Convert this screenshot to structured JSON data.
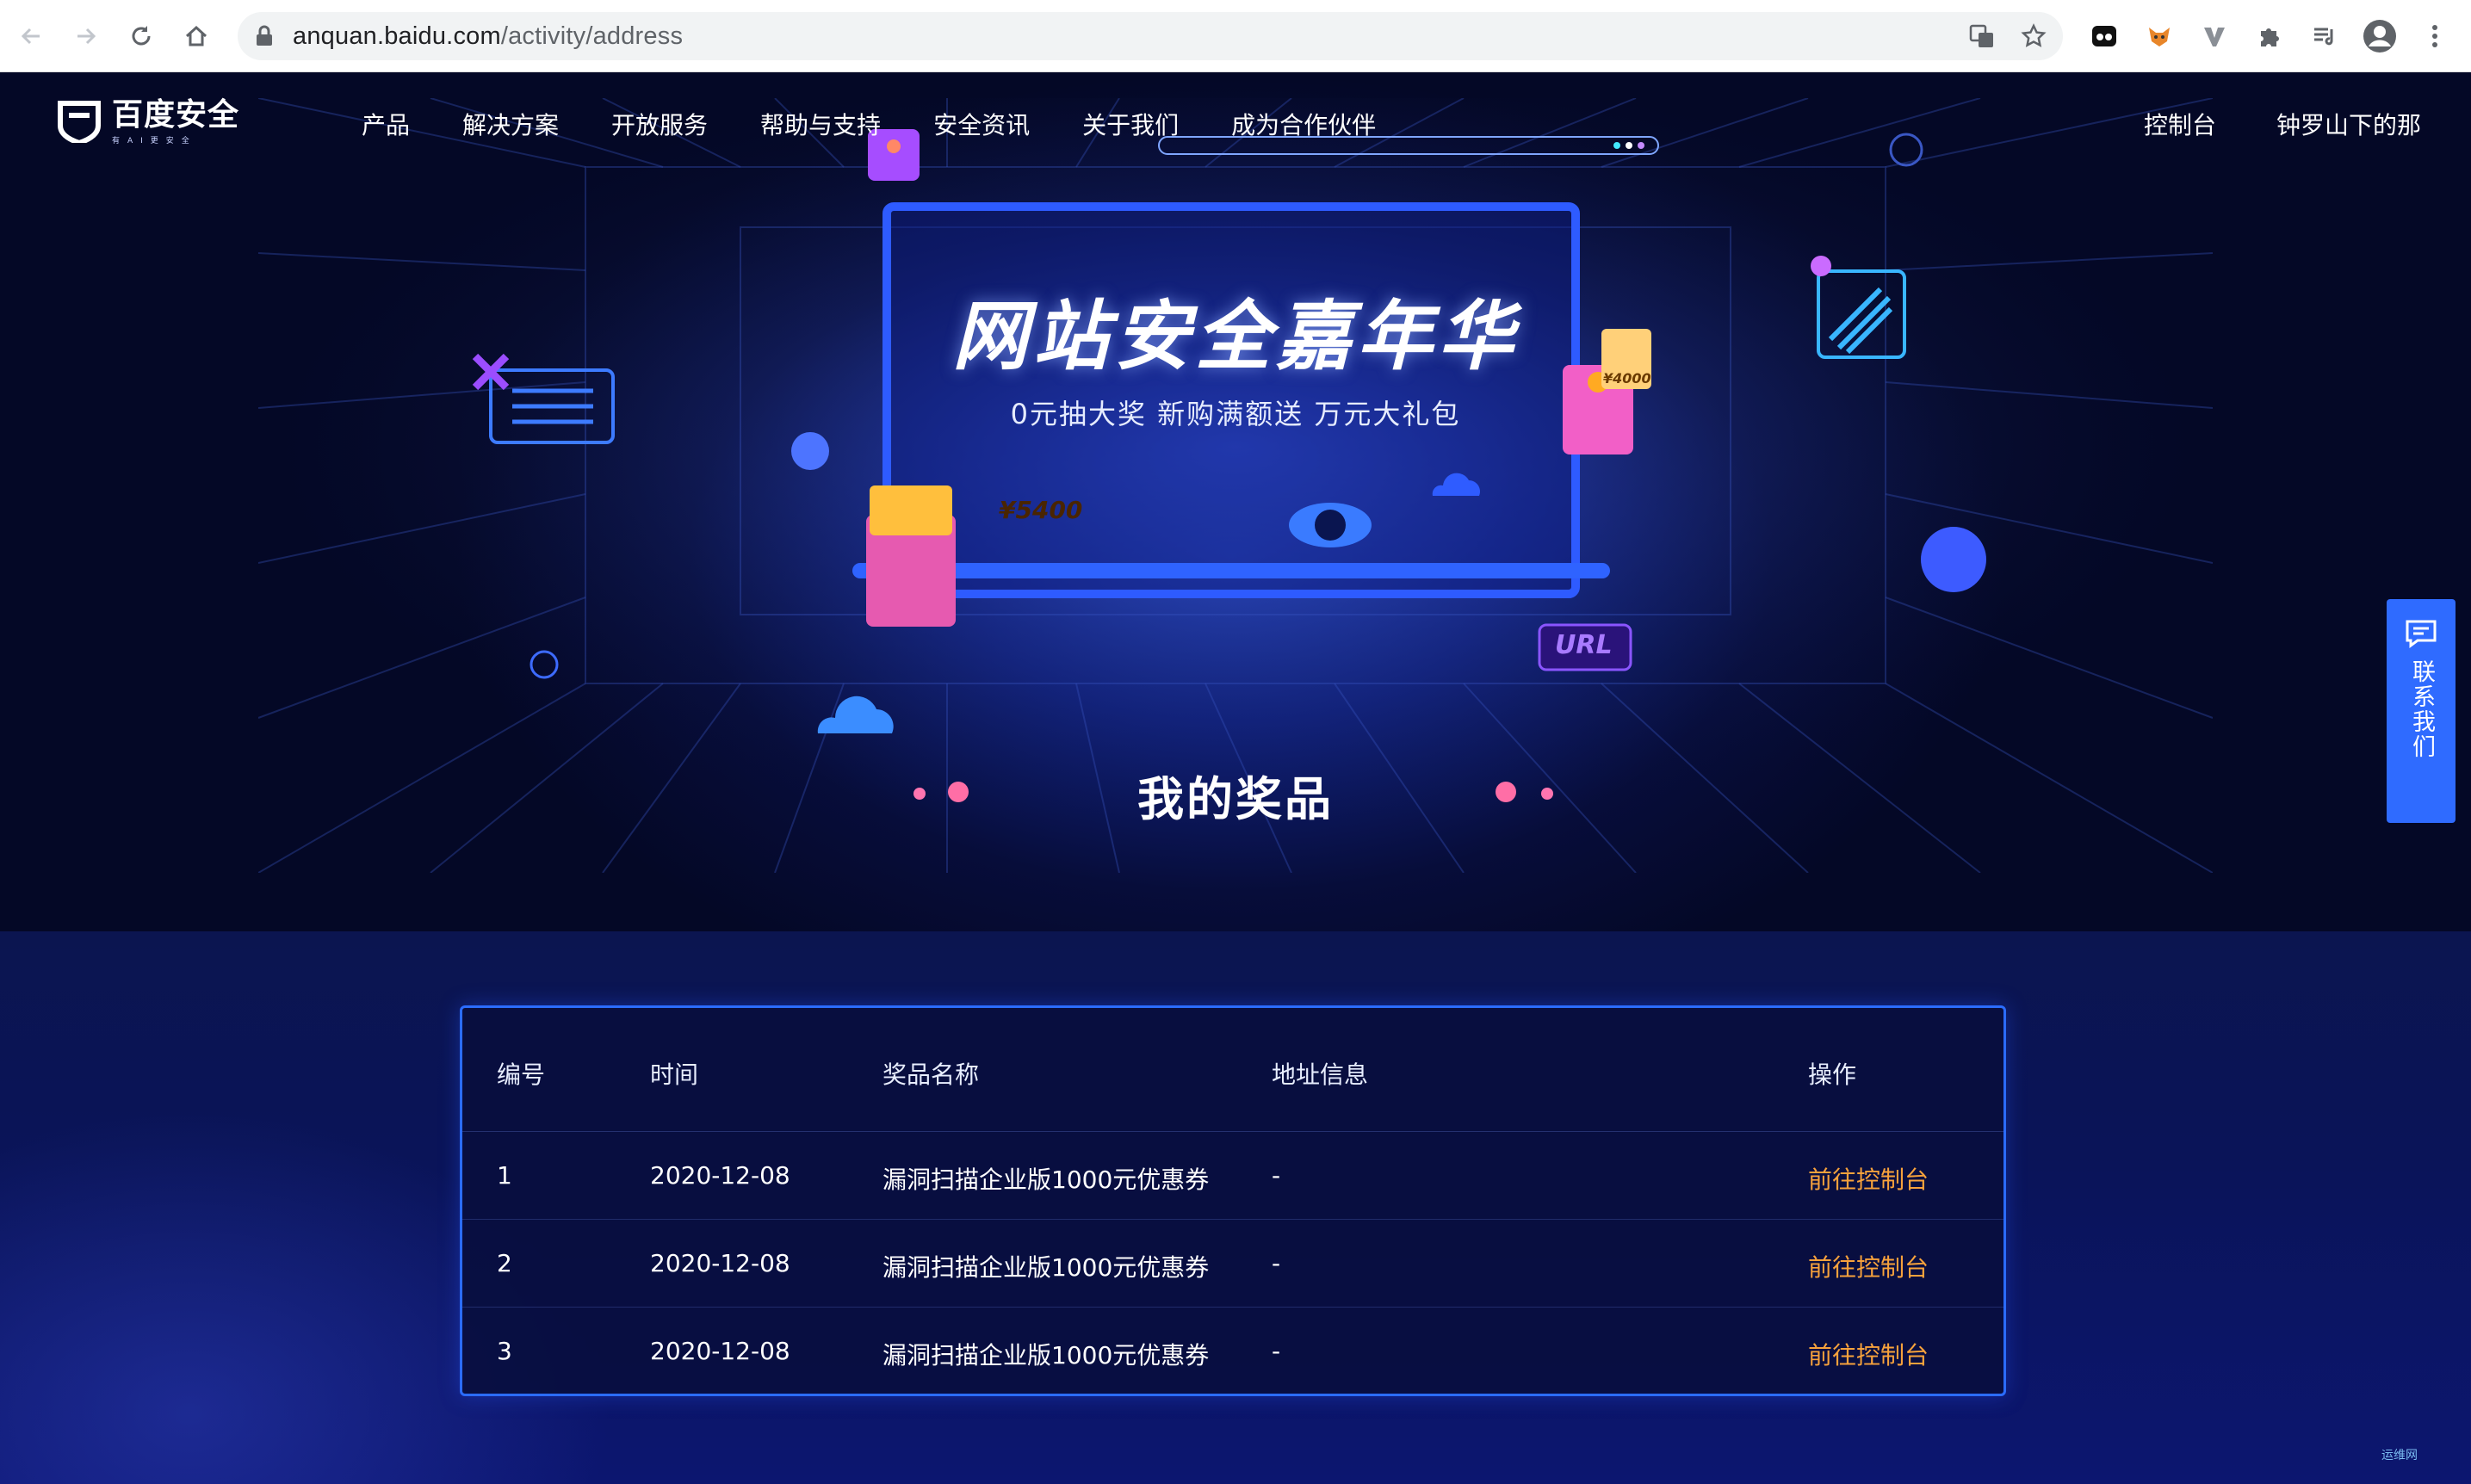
{
  "browser": {
    "url_domain": "anquan.baidu.com",
    "url_path": "/activity/address"
  },
  "header": {
    "logo_text": "百度安全",
    "logo_sub": "有AI更安全",
    "nav": [
      "产品",
      "解决方案",
      "开放服务",
      "帮助与支持",
      "安全资讯",
      "关于我们",
      "成为合作伙伴"
    ],
    "console": "控制台",
    "username": "钟罗山下的那"
  },
  "hero": {
    "title": "网站安全嘉年华",
    "subtitle": "0元抽大奖  新购满额送  万元大礼包",
    "coupon_big": "¥5400",
    "coupon_small": "¥4000",
    "url_badge": "URL"
  },
  "section": {
    "title": "我的奖品"
  },
  "contact": {
    "label": "联系我们"
  },
  "table": {
    "headers": [
      "编号",
      "时间",
      "奖品名称",
      "地址信息",
      "操作"
    ],
    "rows": [
      {
        "id": "1",
        "time": "2020-12-08",
        "prize": "漏洞扫描企业版1000元优惠券",
        "address": "-",
        "action": "前往控制台"
      },
      {
        "id": "2",
        "time": "2020-12-08",
        "prize": "漏洞扫描企业版1000元优惠券",
        "address": "-",
        "action": "前往控制台"
      },
      {
        "id": "3",
        "time": "2020-12-08",
        "prize": "漏洞扫描企业版1000元优惠券",
        "address": "-",
        "action": "前往控制台"
      }
    ]
  },
  "watermark": "运维网",
  "colors": {
    "accent": "#2f6bff",
    "action": "#f7a23c",
    "background": "#050a2e"
  }
}
